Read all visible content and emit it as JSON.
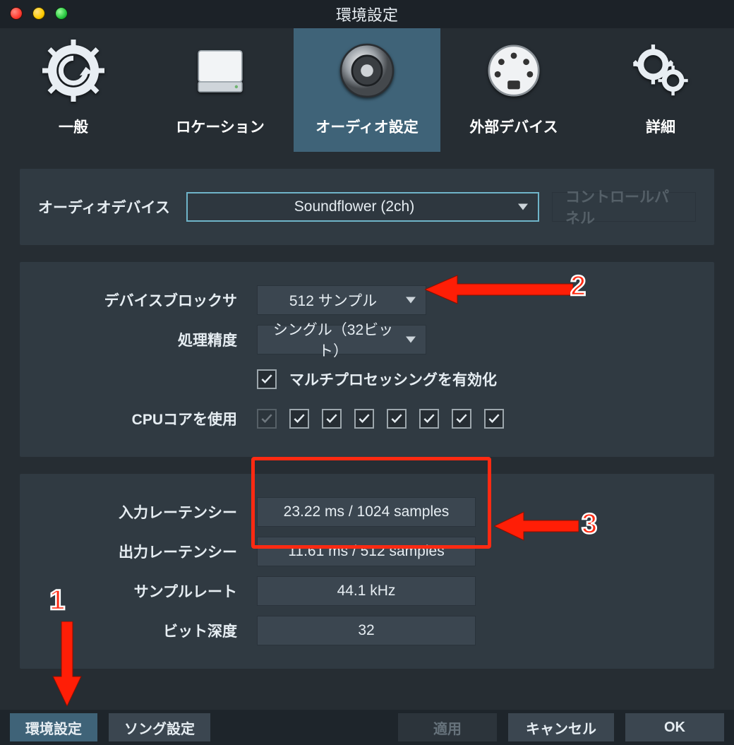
{
  "window": {
    "title": "環境設定"
  },
  "tabs": {
    "general": {
      "label": "一般"
    },
    "location": {
      "label": "ロケーション"
    },
    "audio": {
      "label": "オーディオ設定"
    },
    "external": {
      "label": "外部デバイス"
    },
    "advanced": {
      "label": "詳細"
    }
  },
  "panel1": {
    "audio_device_label": "オーディオデバイス",
    "audio_device_value": "Soundflower (2ch)",
    "control_panel_btn": "コントロールパネル"
  },
  "panel2": {
    "block_size_label": "デバイスブロックサ",
    "block_size_value": "512 サンプル",
    "precision_label": "処理精度",
    "precision_value": "シングル（32ビット）",
    "multiprocessing_label": "マルチプロセッシングを有効化",
    "cpu_cores_label": "CPUコアを使用",
    "cpu_cores": [
      true,
      true,
      true,
      true,
      true,
      true,
      true,
      true
    ]
  },
  "panel3": {
    "in_latency_label": "入力レーテンシー",
    "in_latency_value": "23.22 ms / 1024 samples",
    "out_latency_label": "出力レーテンシー",
    "out_latency_value": "11.61 ms / 512 samples",
    "sample_rate_label": "サンプルレート",
    "sample_rate_value": "44.1 kHz",
    "bit_depth_label": "ビット深度",
    "bit_depth_value": "32"
  },
  "buttons": {
    "pref": "環境設定",
    "song": "ソング設定",
    "apply": "適用",
    "cancel": "キャンセル",
    "ok": "OK"
  },
  "annotations": {
    "n1": "1",
    "n2": "2",
    "n3": "3"
  }
}
